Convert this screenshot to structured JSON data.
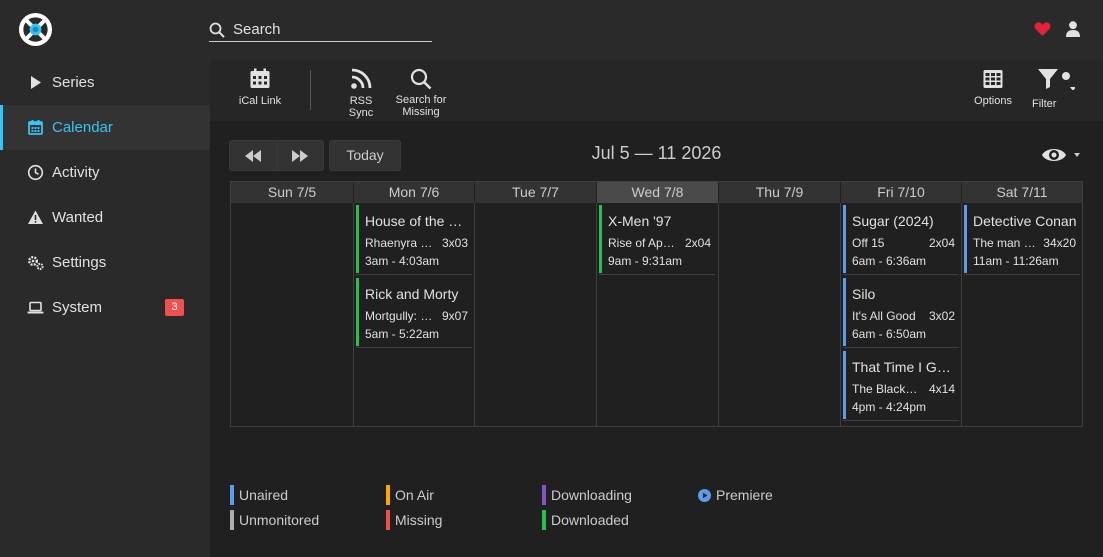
{
  "colors": {
    "accent": "#35c5f4",
    "unaired": "#5d9cec",
    "unmonitored": "#adadad",
    "on_air": "#ffa500",
    "missing": "#f05050",
    "downloading": "#7e57c2",
    "downloaded": "#27c24c",
    "heart": "#e6213a"
  },
  "header": {
    "logo_icon": "sonarr-logo",
    "search_placeholder": "Search",
    "donate_icon": "heart-icon",
    "user_icon": "user-icon"
  },
  "sidebar": {
    "items": [
      {
        "label": "Series",
        "icon": "play-icon"
      },
      {
        "label": "Calendar",
        "icon": "calendar-icon"
      },
      {
        "label": "Activity",
        "icon": "clock-icon"
      },
      {
        "label": "Wanted",
        "icon": "warning-icon"
      },
      {
        "label": "Settings",
        "icon": "cogs-icon"
      },
      {
        "label": "System",
        "icon": "laptop-icon",
        "badge": "3"
      }
    ],
    "active": "Calendar"
  },
  "toolbar": {
    "ical_label": "iCal Link",
    "rss_label": "RSS Sync",
    "search_missing_line1": "Search for",
    "search_missing_line2": "Missing",
    "options_label": "Options",
    "filter_label": "Filter"
  },
  "calendar": {
    "today_label": "Today",
    "range_title": "Jul 5 — 11 2026",
    "days": [
      {
        "label": "Sun 7/5",
        "today": false,
        "events": []
      },
      {
        "label": "Mon 7/6",
        "today": false,
        "events": [
          {
            "title": "House of the Dragon",
            "episode": "Rhaenyra the Cruel",
            "number": "3x03",
            "time": "3am - 4:03am",
            "status": "downloaded"
          },
          {
            "title": "Rick and Morty",
            "episode": "Mortgully: Unicorn",
            "number": "9x07",
            "time": "5am - 5:22am",
            "status": "downloaded"
          }
        ]
      },
      {
        "label": "Tue 7/7",
        "today": false,
        "events": []
      },
      {
        "label": "Wed 7/8",
        "today": true,
        "events": [
          {
            "title": "X-Men '97",
            "episode": "Rise of Apocalypse",
            "number": "2x04",
            "time": "9am - 9:31am",
            "status": "downloaded"
          }
        ]
      },
      {
        "label": "Thu 7/9",
        "today": false,
        "events": []
      },
      {
        "label": "Fri 7/10",
        "today": false,
        "events": [
          {
            "title": "Sugar (2024)",
            "episode": "Off 15",
            "number": "2x04",
            "time": "6am - 6:36am",
            "status": "unaired"
          },
          {
            "title": "Silo",
            "episode": "It's All Good",
            "number": "3x02",
            "time": "6am - 6:50am",
            "status": "unaired"
          },
          {
            "title": "That Time I Got Reincarnated as a Slime",
            "episode": "The Black Knight",
            "number": "4x14",
            "time": "4pm - 4:24pm",
            "status": "unaired"
          }
        ]
      },
      {
        "label": "Sat 7/11",
        "today": false,
        "events": [
          {
            "title": "Detective Conan",
            "episode": "The man who",
            "number": "34x20",
            "time": "11am - 11:26am",
            "status": "unaired"
          }
        ]
      }
    ]
  },
  "legend": {
    "unaired": "Unaired",
    "unmonitored": "Unmonitored",
    "on_air": "On Air",
    "missing": "Missing",
    "downloading": "Downloading",
    "downloaded": "Downloaded",
    "premiere": "Premiere"
  }
}
